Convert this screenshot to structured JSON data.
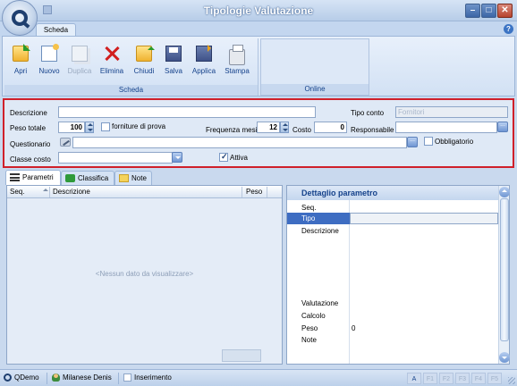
{
  "window": {
    "title": "Tipologie Valutazione",
    "min": "–",
    "max": "□",
    "close": "✕"
  },
  "ribbon": {
    "tab": "Scheda",
    "help": "?",
    "groups": {
      "scheda": "Scheda",
      "online": "Online"
    },
    "buttons": {
      "apri": "Apri",
      "nuovo": "Nuovo",
      "duplica": "Duplica",
      "elimina": "Elimina",
      "chiudi": "Chiudi",
      "salva": "Salva",
      "applica": "Applica",
      "stampa": "Stampa"
    }
  },
  "form": {
    "descrizione_label": "Descrizione",
    "descrizione_value": "",
    "tipo_conto_label": "Tipo conto",
    "tipo_conto_value": "Fornitori",
    "peso_totale_label": "Peso totale",
    "peso_totale_value": "100",
    "forniture_label": "forniture di prova",
    "forniture_checked": false,
    "frequenza_label": "Frequenza mesi",
    "frequenza_value": "12",
    "costo_label": "Costo",
    "costo_value": "0",
    "responsabile_label": "Responsabile",
    "responsabile_value": "",
    "questionario_label": "Questionario",
    "questionario_value": "",
    "obbligatorio_label": "Obbligatorio",
    "obbligatorio_checked": false,
    "classe_costo_label": "Classe costo",
    "classe_costo_value": "",
    "attiva_label": "Attiva",
    "attiva_checked": true
  },
  "tabs": {
    "parametri": "Parametri",
    "classifica": "Classifica",
    "note": "Note"
  },
  "grid": {
    "columns": [
      "Seq.",
      "Descrizione",
      "Peso"
    ],
    "empty_message": "<Nessun dato da visualizzare>"
  },
  "detail": {
    "title": "Dettaglio parametro",
    "rows": [
      {
        "key": "Seq.",
        "value": ""
      },
      {
        "key": "Tipo",
        "value": ""
      },
      {
        "key": "Descrizione",
        "value": ""
      },
      {
        "key": "Valutazione",
        "value": ""
      },
      {
        "key": "Calcolo",
        "value": ""
      },
      {
        "key": "Peso",
        "value": "0"
      },
      {
        "key": "Note",
        "value": ""
      }
    ]
  },
  "statusbar": {
    "app": "QDemo",
    "user": "Milanese Denis",
    "mode": "Inserimento",
    "keys": [
      "A",
      "F1",
      "F2",
      "F3",
      "F4",
      "F5"
    ]
  },
  "colors": {
    "highlight_border": "#d0202a",
    "accent": "#15428b",
    "selected_row": "#3e6dc2"
  }
}
